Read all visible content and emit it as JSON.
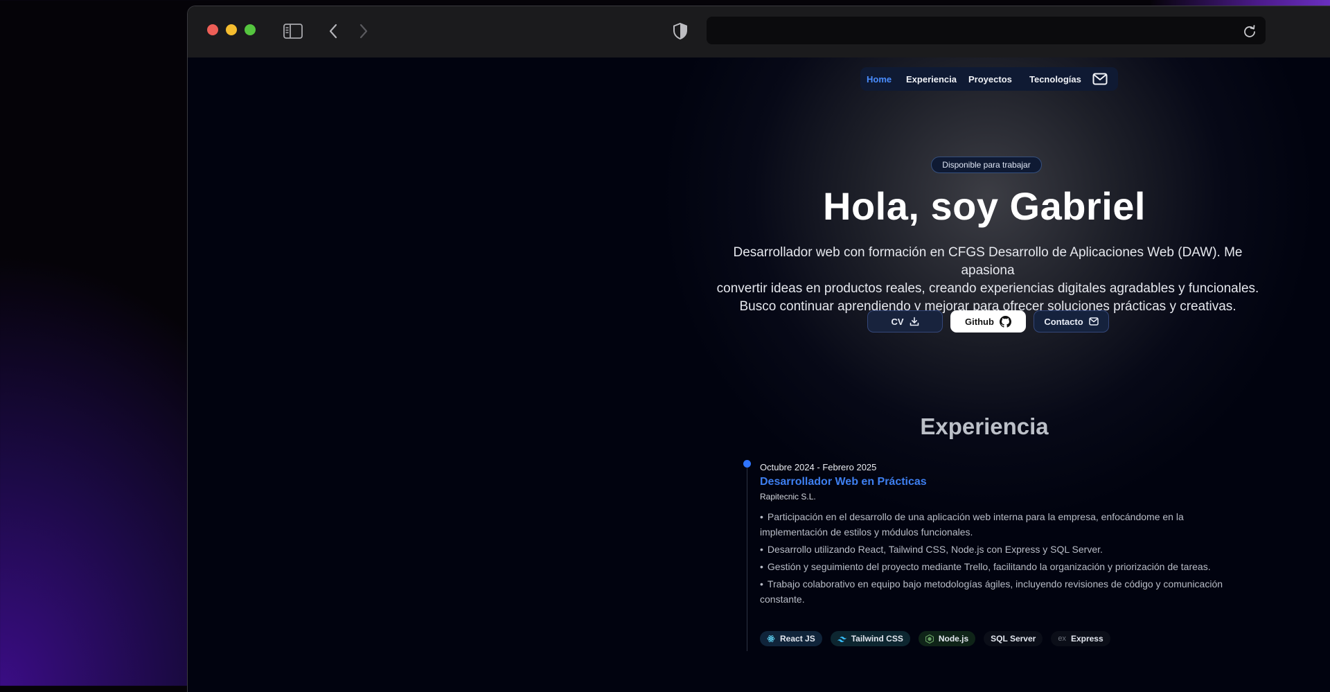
{
  "nav": {
    "items": [
      {
        "label": "Home"
      },
      {
        "label": "Experiencia"
      },
      {
        "label": "Proyectos"
      },
      {
        "label": "Tecnologías"
      }
    ],
    "active": "Home"
  },
  "hero": {
    "badge": "Disponible para trabajar",
    "title": "Hola, soy Gabriel",
    "description_lines": [
      "Desarrollador web con formación en CFGS Desarrollo de Aplicaciones Web (DAW). Me apasiona",
      "convertir ideas en productos reales, creando experiencias digitales agradables y funcionales.",
      "Busco continuar aprendiendo y mejorar para ofrecer soluciones prácticas y creativas."
    ],
    "buttons": {
      "cv": "CV",
      "github": "Github",
      "contact": "Contacto"
    }
  },
  "experience": {
    "section_title": "Experiencia",
    "items": [
      {
        "date": "Octubre 2024 - Febrero 2025",
        "role": "Desarrollador Web en Prácticas",
        "company": "Rapitecnic S.L.",
        "bullets": [
          "Participación en el desarrollo de una aplicación web interna para la empresa, enfocándome en la implementación de estilos y módulos funcionales.",
          "Desarrollo utilizando React, Tailwind CSS, Node.js con Express y SQL Server.",
          "Gestión y seguimiento del proyecto mediante Trello, facilitando la organización y priorización de tareas.",
          "Trabajo colaborativo en equipo bajo metodologías ágiles, incluyendo revisiones de código y comunicación constante."
        ],
        "tags": [
          {
            "label": "React JS",
            "icon": "react-icon",
            "color": "#61dafb",
            "bg": "#10243a"
          },
          {
            "label": "Tailwind CSS",
            "icon": "tailwind-icon",
            "color": "#38bdf8",
            "bg": "#0d2630"
          },
          {
            "label": "Node.js",
            "icon": "nodejs-icon",
            "color": "#68a063",
            "bg": "#0f2418"
          },
          {
            "label": "SQL Server",
            "icon": "",
            "color": "#e3e7ef",
            "bg": "#0b0e18"
          },
          {
            "label": "Express",
            "icon": "express-icon",
            "color": "#8a8f99",
            "bg": "#0b0e18"
          }
        ]
      }
    ]
  },
  "colors": {
    "accent": "#4a8dff",
    "timeline_dot": "#2f75ff",
    "role": "#3e7ff0"
  }
}
